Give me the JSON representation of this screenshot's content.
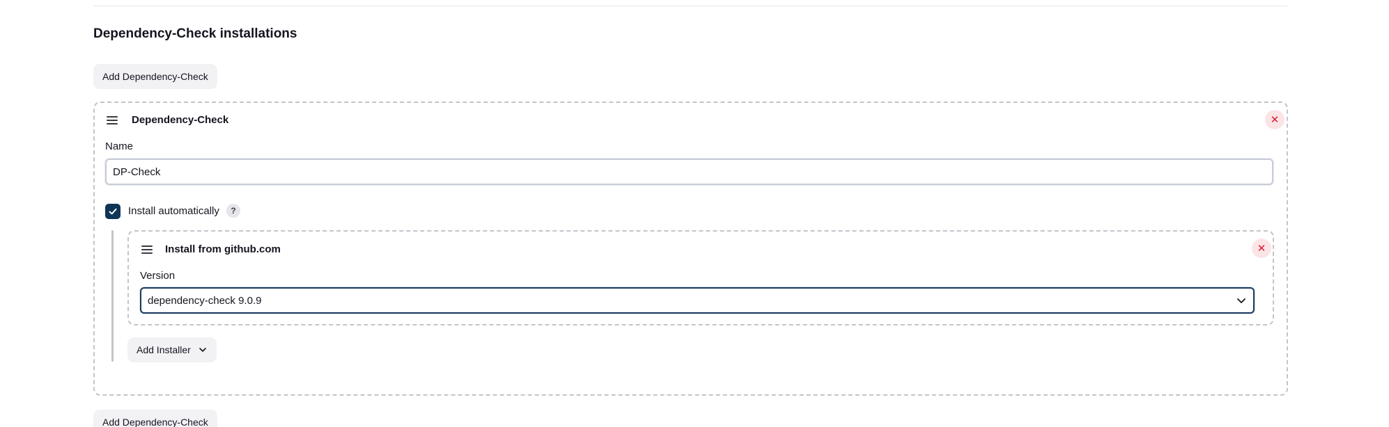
{
  "section": {
    "title": "Dependency-Check installations",
    "add_button_label": "Add Dependency-Check",
    "add_button_bottom_label": "Add Dependency-Check"
  },
  "installation": {
    "title": "Dependency-Check",
    "delete_symbol": "✕",
    "name_label": "Name",
    "name_value": "DP-Check",
    "install_auto_label": "Install automatically",
    "install_auto_checked": true,
    "help_symbol": "?",
    "installer": {
      "title": "Install from github.com",
      "delete_symbol": "✕",
      "version_label": "Version",
      "version_selected": "dependency-check 9.0.9"
    },
    "add_installer_label": "Add Installer"
  },
  "icons": {
    "drag_handle": "drag-handle-icon",
    "delete": "close-icon",
    "check": "check-icon",
    "chevron": "chevron-down-icon",
    "help": "help-icon"
  },
  "colors": {
    "checkbox_fill": "#0e3556",
    "delete_bg": "#fbe4e6",
    "delete_fg": "#e0192f",
    "select_border": "#1b3a5c",
    "button_bg": "#f2f2f5",
    "dashed_border": "#c3c5cc"
  }
}
